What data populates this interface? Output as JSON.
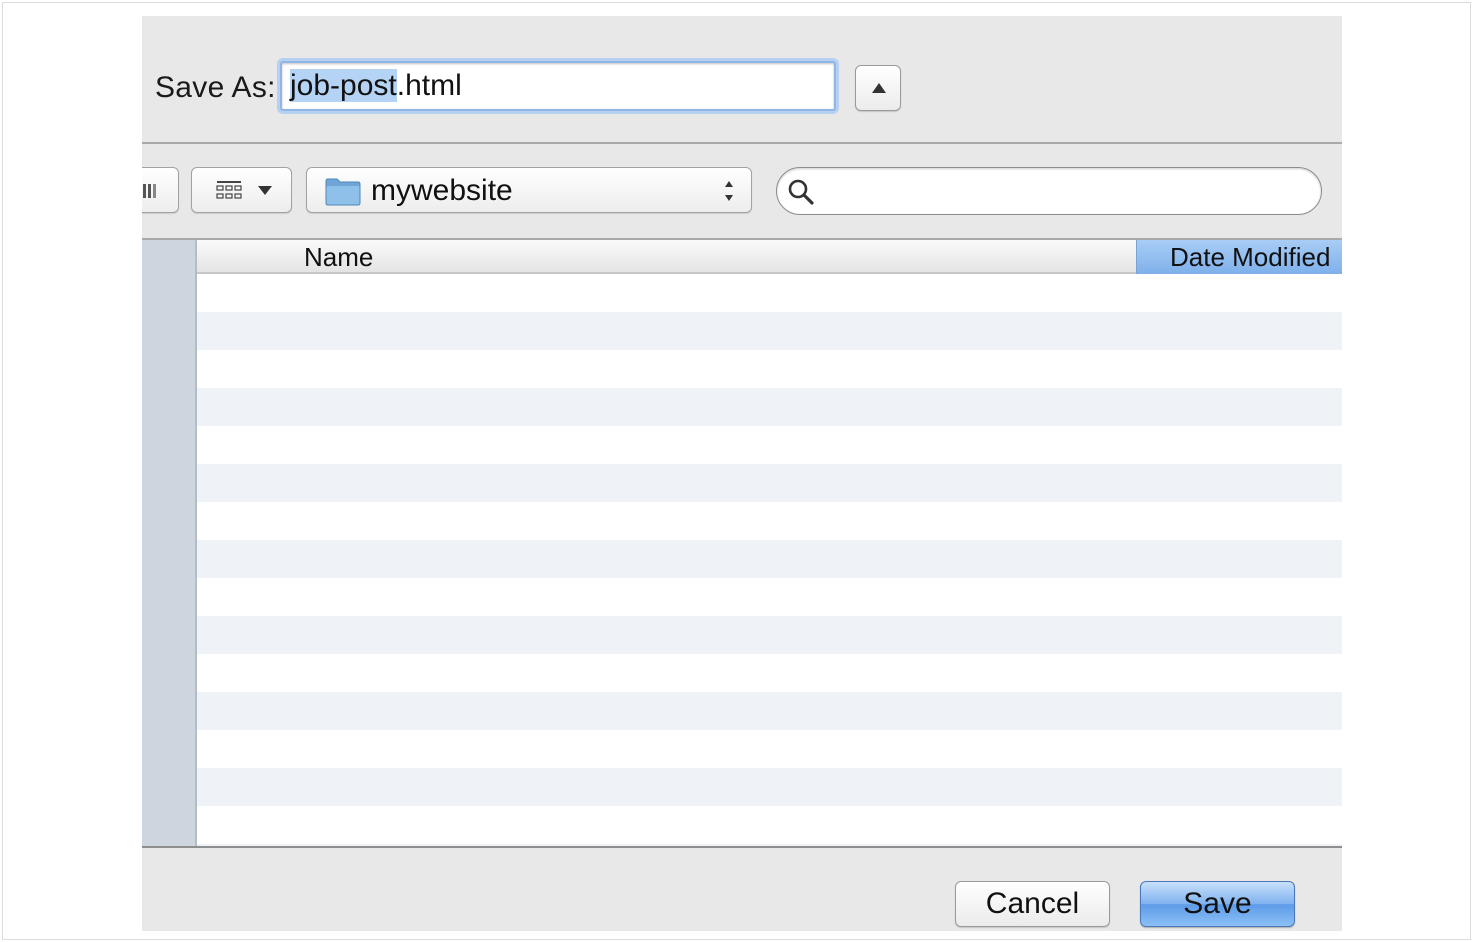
{
  "dialog": {
    "save_as_label": "Save As:",
    "filename_selected": "job-post",
    "filename_rest": ".html"
  },
  "toolbar": {
    "location": "mywebsite",
    "search_value": ""
  },
  "file_list": {
    "columns": [
      "Name",
      "Date Modified"
    ],
    "sorted_column": "Date Modified",
    "rows": []
  },
  "buttons": {
    "cancel_label": "Cancel",
    "save_label": "Save"
  },
  "colors": {
    "selection": "#b5d3f5",
    "accent": "#5d9be8",
    "sidebar": "#cdd5df",
    "row_alt": "#eff2f7"
  }
}
